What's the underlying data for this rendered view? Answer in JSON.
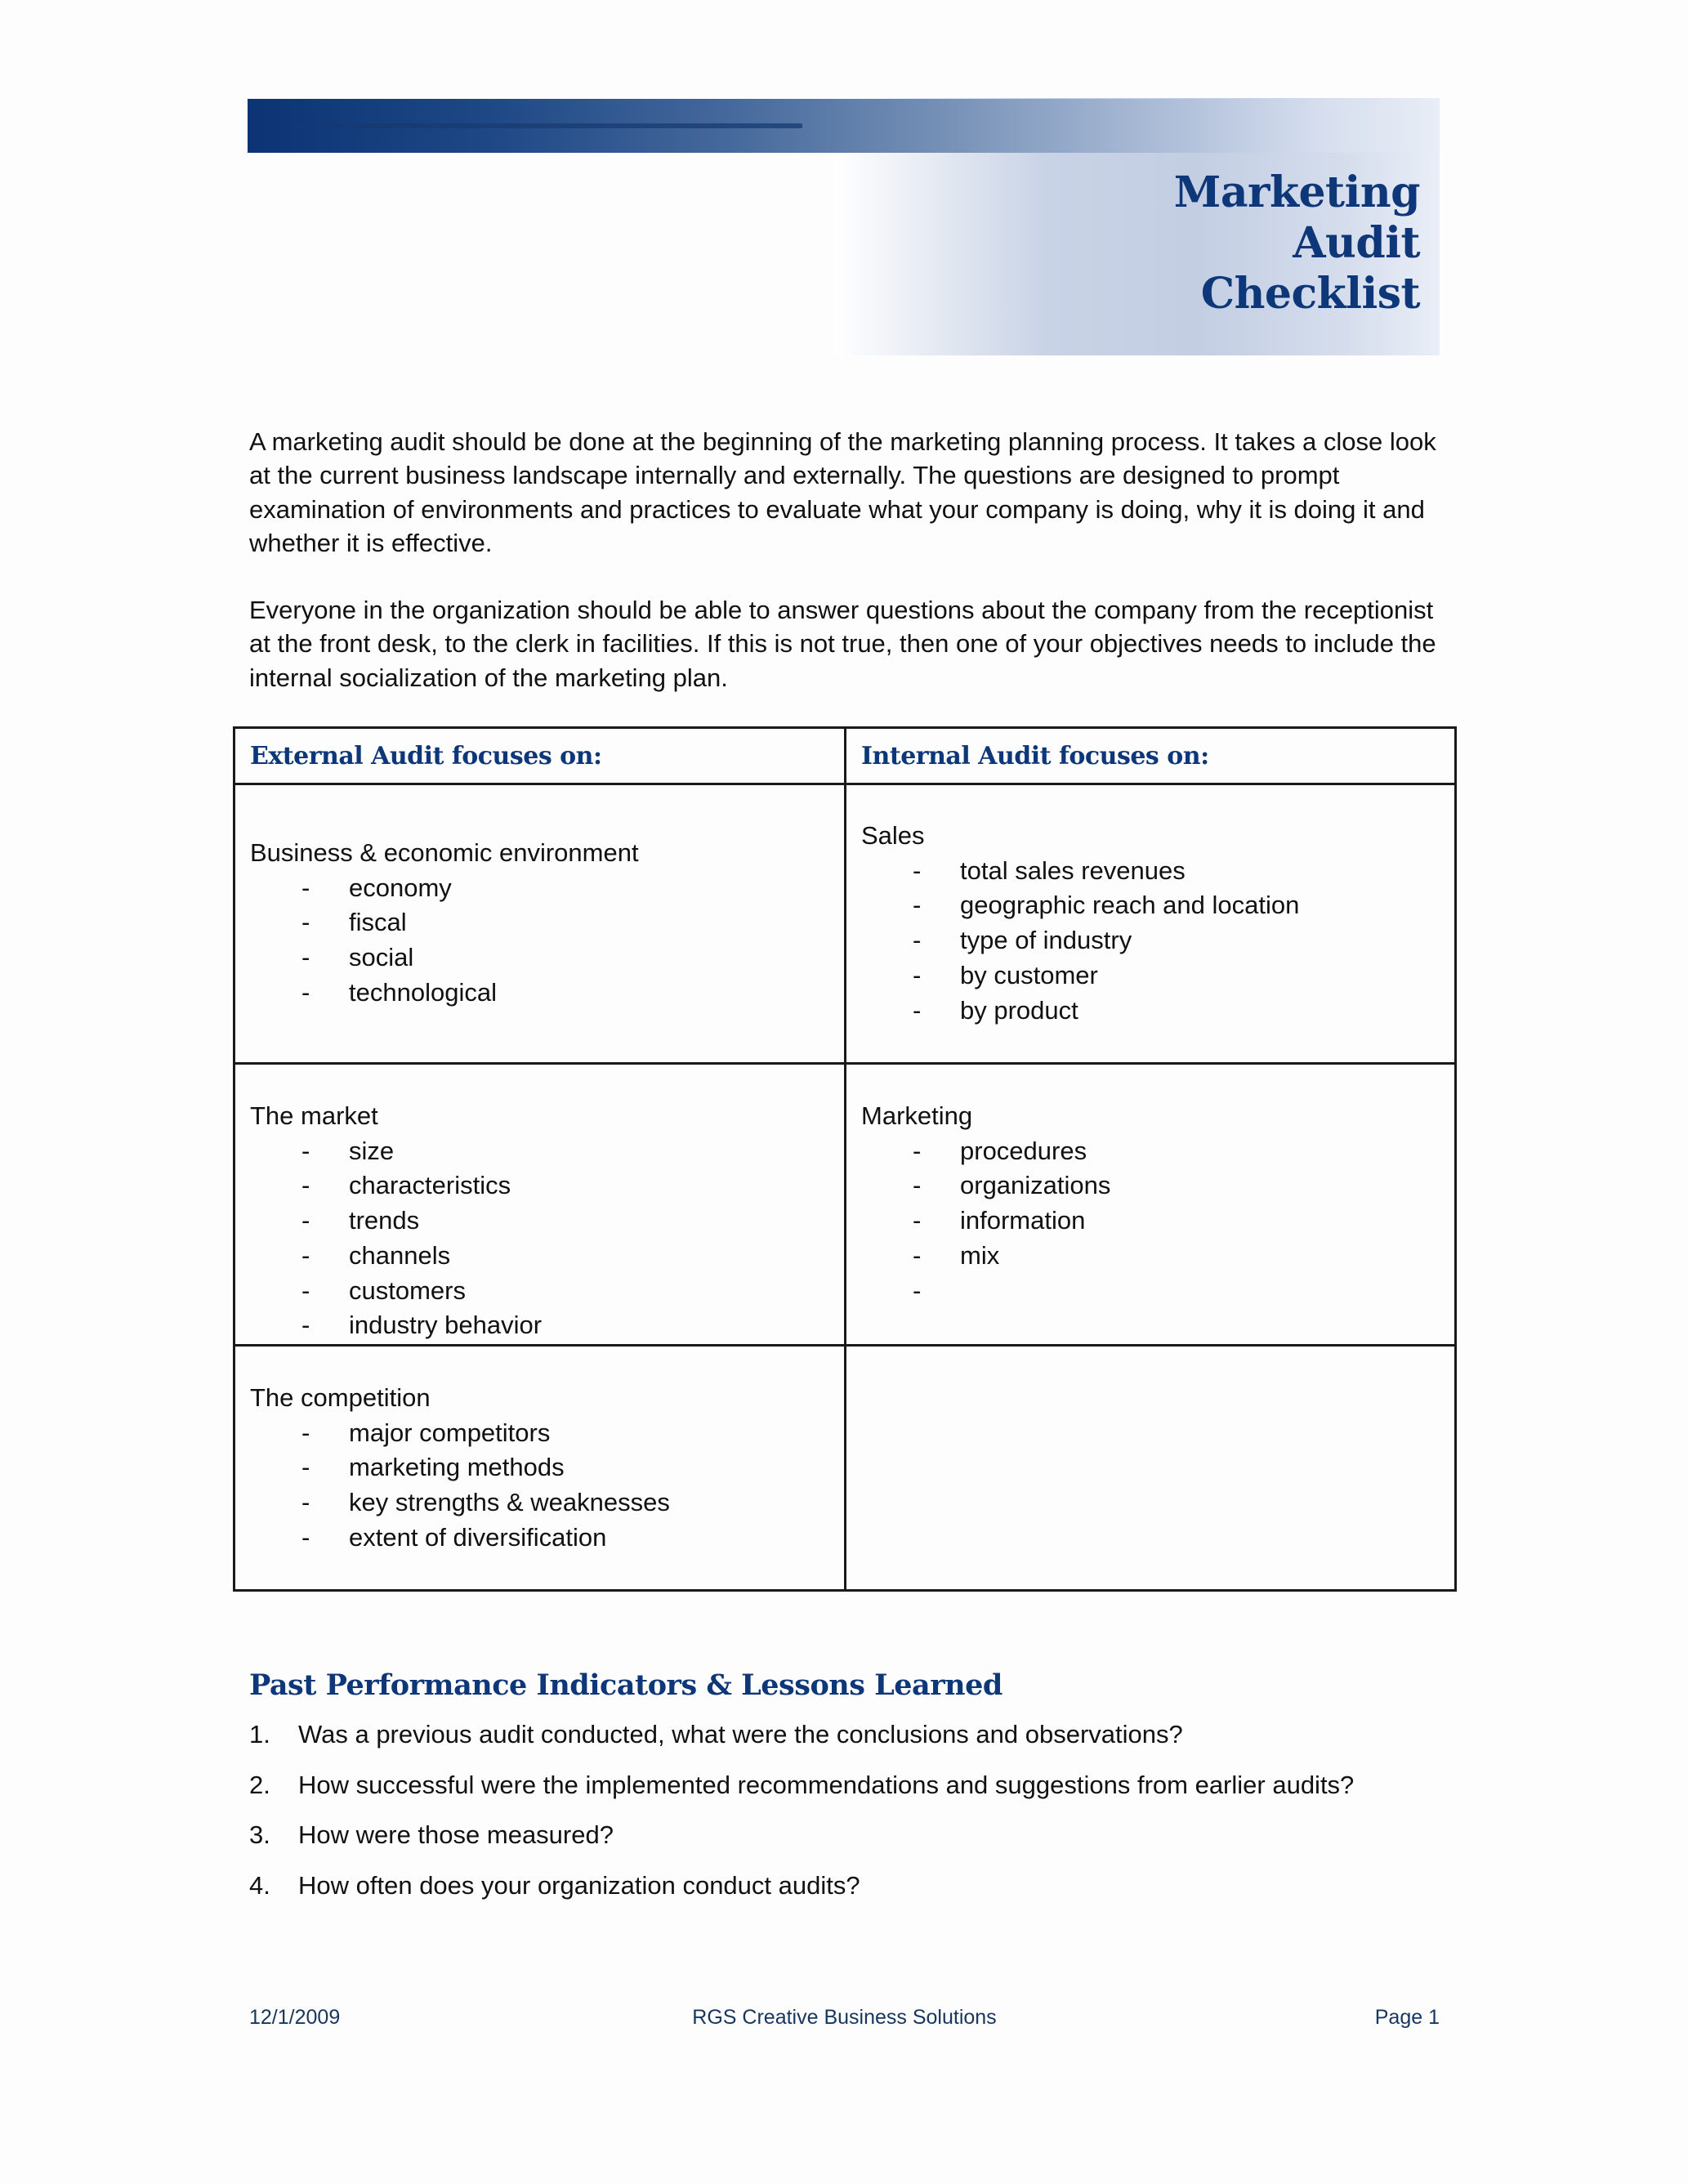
{
  "header": {
    "title_lines": [
      "Marketing",
      "Audit",
      "Checklist"
    ],
    "accent_color": "#0d3778"
  },
  "intro": {
    "paragraph_1": "A marketing audit should be done at the beginning of the marketing planning process.  It takes a close look at the current business landscape internally and externally.  The questions are designed to prompt examination of environments and practices to evaluate what your company is doing, why it is doing it and whether it is effective.",
    "paragraph_2": "Everyone in the organization should be able to answer questions about the company from the receptionist at the front desk, to the clerk in facilities.  If this is not true, then one of your objectives needs to include the internal socialization of the marketing plan."
  },
  "audit_table": {
    "headers": [
      "External Audit focuses on:",
      "Internal Audit focuses on:"
    ],
    "bullet": "-",
    "rows": [
      {
        "external": {
          "heading": "Business & economic environment",
          "items": [
            "economy",
            "fiscal",
            "social",
            "technological"
          ]
        },
        "internal": {
          "heading": "Sales",
          "items": [
            "total sales revenues",
            "geographic reach and location",
            "type of industry",
            "by customer",
            "by product"
          ]
        }
      },
      {
        "external": {
          "heading": "The market",
          "items": [
            "size",
            "characteristics",
            "trends",
            "channels",
            "customers",
            "industry behavior"
          ]
        },
        "internal": {
          "heading": "Marketing",
          "items": [
            "procedures",
            "organizations",
            "information",
            "mix",
            ""
          ]
        }
      },
      {
        "external": {
          "heading": "The competition",
          "items": [
            "major competitors",
            "marketing methods",
            "key strengths & weaknesses",
            "extent of diversification"
          ]
        },
        "internal": {
          "heading": "",
          "items": []
        }
      }
    ]
  },
  "past_performance": {
    "title": "Past Performance Indicators & Lessons Learned",
    "questions": [
      {
        "num": "1.",
        "text": "Was a previous audit conducted, what were the conclusions and observations?"
      },
      {
        "num": "2.",
        "text": "How successful were the implemented recommendations and suggestions from earlier audits?"
      },
      {
        "num": "3.",
        "text": "How were those measured?"
      },
      {
        "num": "4.",
        "text": "How often does your organization conduct audits?"
      }
    ]
  },
  "footer": {
    "date": "12/1/2009",
    "company": "RGS Creative Business Solutions",
    "page": "Page 1"
  }
}
